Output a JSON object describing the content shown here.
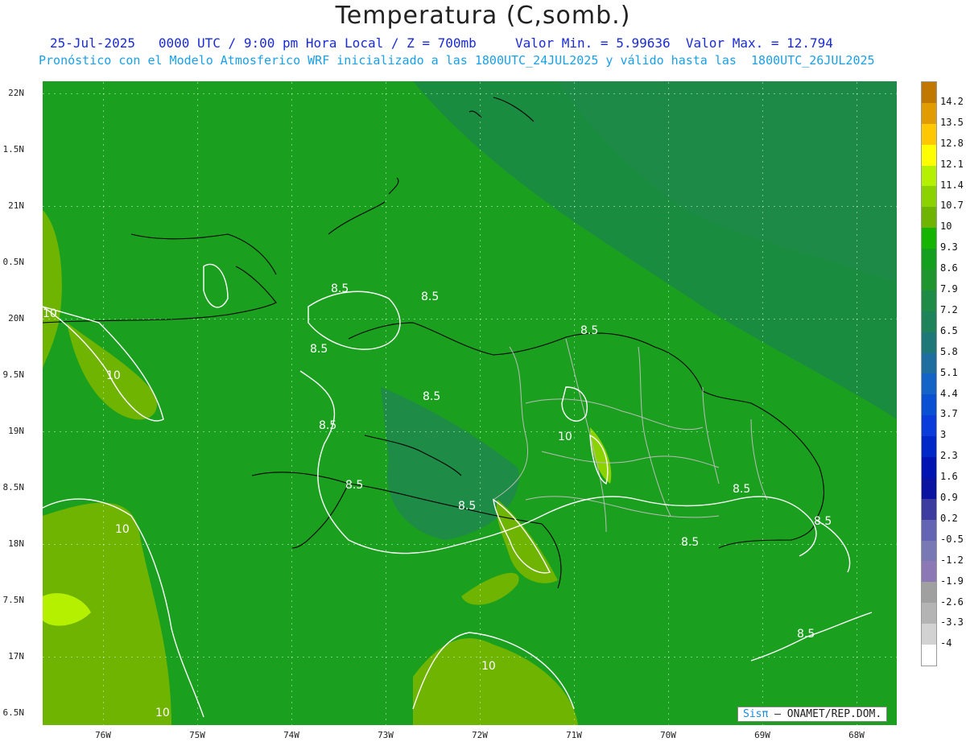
{
  "title": "Temperatura (C,somb.)",
  "subtitle_line1": "25-Jul-2025   0000 UTC / 9:00 pm Hora Local / Z = 700mb     Valor Min. = 5.99636  Valor Max. = 12.794",
  "subtitle_line2": "Pronóstico con el Modelo Atmosferico WRF inicializado a las 1800UTC_24JUL2025 y válido hasta las  1800UTC_26JUL2025",
  "credit": {
    "brand": "Sisπ",
    "text": "– ONAMET/REP.DOM."
  },
  "lat_labels": [
    "22N",
    "1.5N",
    "21N",
    "0.5N",
    "20N",
    "9.5N",
    "19N",
    "8.5N",
    "18N",
    "7.5N",
    "17N",
    "6.5N"
  ],
  "lon_labels": [
    "76W",
    "75W",
    "74W",
    "73W",
    "72W",
    "71W",
    "70W",
    "69W",
    "68W"
  ],
  "contour_labels": [
    "8.5",
    "8.5",
    "8.5",
    "8.5",
    "8.5",
    "8.5",
    "8.5",
    "8.5",
    "8.5",
    "8.5",
    "8.5",
    "8.5",
    "10",
    "10",
    "10",
    "10",
    "10",
    "10"
  ],
  "colorbar": {
    "labels": [
      "14.2",
      "13.5",
      "12.8",
      "12.1",
      "11.4",
      "10.7",
      "10",
      "9.3",
      "8.6",
      "7.9",
      "7.2",
      "6.5",
      "5.8",
      "5.1",
      "4.4",
      "3.7",
      "3",
      "2.3",
      "1.6",
      "0.9",
      "0.2",
      "-0.5",
      "-1.2",
      "-1.9",
      "-2.6",
      "-3.3",
      "-4"
    ],
    "colors": [
      "#c07800",
      "#e09c00",
      "#ffc800",
      "#ffff00",
      "#b4f000",
      "#8cd200",
      "#6eb400",
      "#14b400",
      "#14a01e",
      "#1e962d",
      "#1e8c46",
      "#1e825a",
      "#1e7878",
      "#1e6ea0",
      "#1464c8",
      "#0a50d2",
      "#0a3cdc",
      "#0028c8",
      "#0014b4",
      "#0a14a0",
      "#3c3ca0",
      "#6464b4",
      "#7878b4",
      "#8c78b4",
      "#a0a0a0",
      "#b4b4b4",
      "#d2d2d2",
      "#ffffff"
    ]
  }
}
